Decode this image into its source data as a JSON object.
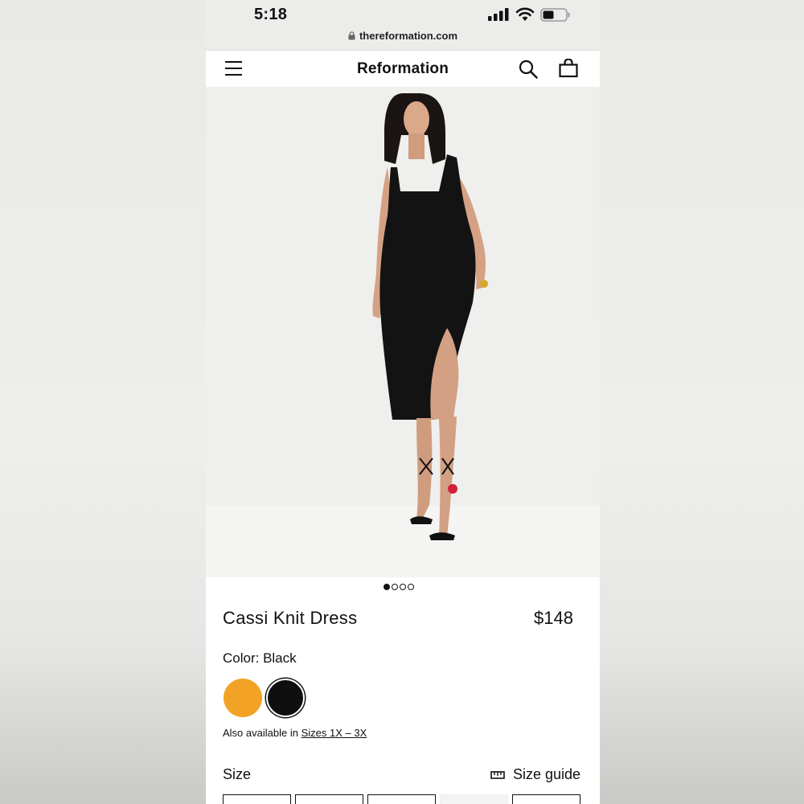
{
  "status_bar": {
    "time": "5:18",
    "url": "thereformation.com"
  },
  "nav": {
    "brand": "Reformation",
    "icons": [
      "menu-icon",
      "search-icon",
      "bag-icon"
    ]
  },
  "carousel": {
    "slide_count": 4,
    "active_index": 0
  },
  "product": {
    "name": "Cassi Knit Dress",
    "price": "$148",
    "color_label": "Color: Black",
    "swatches": [
      {
        "name": "orange",
        "color": "#f2a224",
        "selected": false
      },
      {
        "name": "black",
        "color": "#0f0f0f",
        "selected": true
      }
    ],
    "also_prefix": "Also available in",
    "also_link": "Sizes 1X – 3X"
  },
  "size": {
    "label": "Size",
    "guide_label": "Size guide"
  }
}
